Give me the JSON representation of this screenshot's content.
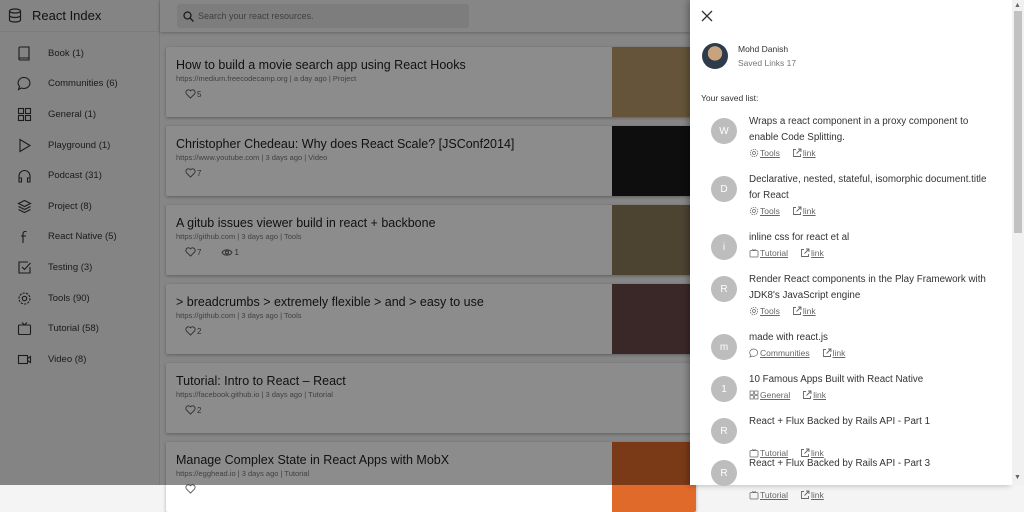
{
  "app": {
    "title": "React Index"
  },
  "sidebar": {
    "items": [
      {
        "label": "Book (1)",
        "icon": "book-icon"
      },
      {
        "label": "Communities (6)",
        "icon": "chat-icon"
      },
      {
        "label": "General (1)",
        "icon": "grid-icon"
      },
      {
        "label": "Playground (1)",
        "icon": "play-icon"
      },
      {
        "label": "Podcast (31)",
        "icon": "headphones-icon"
      },
      {
        "label": "Project (8)",
        "icon": "layers-icon"
      },
      {
        "label": "React Native (5)",
        "icon": "facebook-icon"
      },
      {
        "label": "Testing (3)",
        "icon": "checkbox-icon"
      },
      {
        "label": "Tools (90)",
        "icon": "gear-icon"
      },
      {
        "label": "Tutorial (58)",
        "icon": "tv-icon"
      },
      {
        "label": "Video (8)",
        "icon": "video-icon"
      }
    ]
  },
  "search": {
    "placeholder": "Search your react resources."
  },
  "cards": [
    {
      "title": "How to build a movie search app using React Hooks",
      "meta": "https://medium.freecodecamp.org | a day ago | Project",
      "likes": "5",
      "views": null,
      "img": "#b89a6a"
    },
    {
      "title": "Christopher Chedeau: Why does React Scale? [JSConf2014]",
      "meta": "https://www.youtube.com | 3 days ago | Video",
      "likes": "7",
      "views": null,
      "img": "#1a1a1a"
    },
    {
      "title": "A gitub issues viewer build in react + backbone",
      "meta": "https://github.com | 3 days ago | Tools",
      "likes": "7",
      "views": "1",
      "img": "#8a7a5a"
    },
    {
      "title": "> breadcrumbs > extremely flexible > and > easy to use",
      "meta": "https://github.com | 3 days ago | Tools",
      "likes": "2",
      "views": null,
      "img": "#6a4a4a"
    },
    {
      "title": "Tutorial: Intro to React – React",
      "meta": "https://facebook.github.io | 3 days ago | Tutorial",
      "likes": "2",
      "views": null,
      "img": null
    },
    {
      "title": "Manage Complex State in React Apps with MobX",
      "meta": "https://egghead.io | 3 days ago | Tutorial",
      "likes": "",
      "views": null,
      "img": "#e06a2a"
    }
  ],
  "drawer": {
    "user_name": "Mohd Danish",
    "saved_links": "Saved Links 17",
    "saved_heading": "Your saved list:",
    "link_label": "link",
    "items": [
      {
        "initial": "W",
        "title": "Wraps a react component in a proxy component to enable Code Splitting.",
        "tag": "Tools",
        "tag_icon": "gear-icon"
      },
      {
        "initial": "D",
        "title": "Declarative, nested, stateful, isomorphic document.title for React",
        "tag": "Tools",
        "tag_icon": "gear-icon"
      },
      {
        "initial": "i",
        "title": "inline css for react et al",
        "tag": "Tutorial",
        "tag_icon": "tv-icon"
      },
      {
        "initial": "R",
        "title": "Render React components in the Play Framework with JDK8's JavaScript engine",
        "tag": "Tools",
        "tag_icon": "gear-icon"
      },
      {
        "initial": "m",
        "title": "made with react.js",
        "tag": "Communities",
        "tag_icon": "chat-icon"
      },
      {
        "initial": "1",
        "title": "10 Famous Apps Built with React Native",
        "tag": "General",
        "tag_icon": "grid-icon"
      },
      {
        "initial": "R",
        "title": "React + Flux Backed by Rails API - Part 1",
        "tag": "Tutorial",
        "tag_icon": "tv-icon"
      },
      {
        "initial": "R",
        "title": "React + Flux Backed by Rails API - Part 3",
        "tag": "Tutorial",
        "tag_icon": "tv-icon"
      }
    ]
  }
}
